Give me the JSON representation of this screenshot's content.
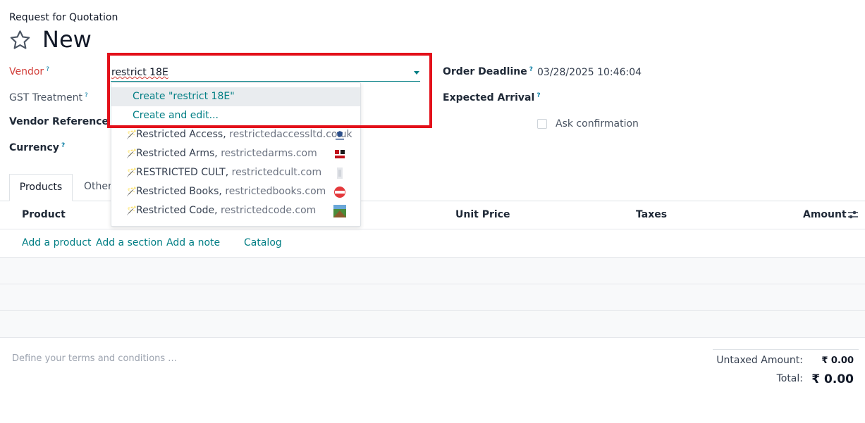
{
  "breadcrumb": "Request for Quotation",
  "record_title": "New",
  "form": {
    "vendor": {
      "label": "Vendor",
      "help": "?",
      "value": "restrict 18E"
    },
    "gst_treatment": {
      "label": "GST Treatment",
      "help": "?"
    },
    "vendor_reference": {
      "label": "Vendor Reference",
      "help": "?"
    },
    "currency": {
      "label": "Currency",
      "help": "?"
    },
    "order_deadline": {
      "label": "Order Deadline",
      "help": "?",
      "value": "03/28/2025 10:46:04"
    },
    "expected_arrival": {
      "label": "Expected Arrival",
      "help": "?"
    },
    "ask_confirmation": {
      "label": "Ask confirmation",
      "checked": false
    }
  },
  "dropdown": {
    "create_label": "Create \"restrict 18E\"",
    "create_edit_label": "Create and edit...",
    "vendors": [
      {
        "name": "Restricted Access",
        "website": "restrictedaccessltd.co.uk"
      },
      {
        "name": "Restricted Arms",
        "website": "restrictedarms.com"
      },
      {
        "name": "RESTRICTED CULT",
        "website": "restrictedcult.com"
      },
      {
        "name": "Restricted Books",
        "website": "restrictedbooks.com"
      },
      {
        "name": "Restricted Code",
        "website": "restrictedcode.com"
      }
    ]
  },
  "tabs": {
    "products": "Products",
    "other": "Other"
  },
  "table": {
    "headers": {
      "product": "Product",
      "unit_price": "Unit Price",
      "taxes": "Taxes",
      "amount": "Amount"
    },
    "actions": {
      "add_product": "Add a product",
      "add_section": "Add a section",
      "add_note": "Add a note",
      "catalog": "Catalog"
    }
  },
  "terms_placeholder": "Define your terms and conditions ...",
  "totals": {
    "untaxed_label": "Untaxed Amount:",
    "untaxed_value": "₹ 0.00",
    "total_label": "Total:",
    "total_value": "₹ 0.00"
  },
  "colors": {
    "accent": "#017e84",
    "required": "#d23f3a",
    "highlight_box": "#e3101a"
  }
}
